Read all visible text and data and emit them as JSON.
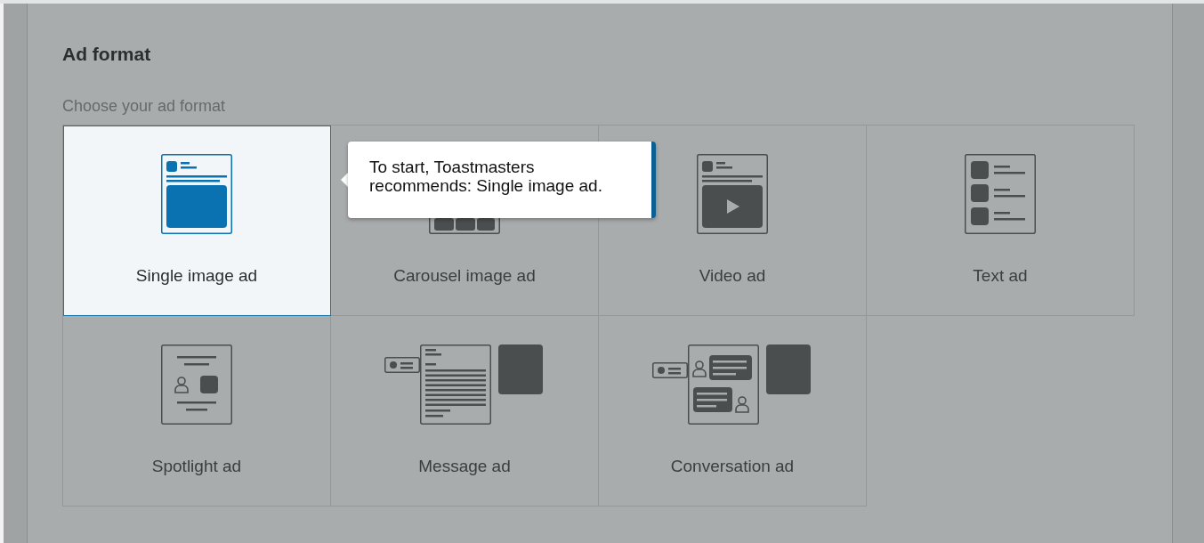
{
  "section": {
    "title": "Ad format",
    "subtitle": "Choose your ad format"
  },
  "formats": [
    {
      "label": "Single image ad",
      "kind": "single",
      "selected": true
    },
    {
      "label": "Carousel image ad",
      "kind": "carousel",
      "selected": false
    },
    {
      "label": "Video ad",
      "kind": "video",
      "selected": false
    },
    {
      "label": "Text ad",
      "kind": "text",
      "selected": false
    },
    {
      "label": "Spotlight ad",
      "kind": "spotlight",
      "selected": false
    },
    {
      "label": "Message ad",
      "kind": "message",
      "selected": false
    },
    {
      "label": "Conversation ad",
      "kind": "conversation",
      "selected": false
    }
  ],
  "tooltip": {
    "text": "To start, Toastmasters recommends: Single image ad."
  }
}
